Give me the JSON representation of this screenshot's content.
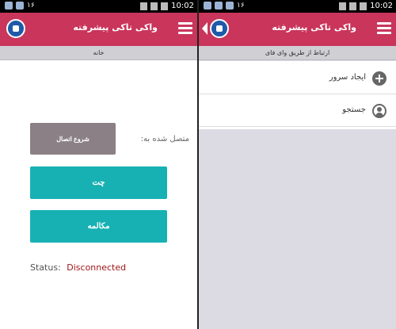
{
  "status_bar": {
    "left_badge": "۱۶",
    "time": "10:02"
  },
  "app": {
    "title": "واکی تاکی پیشرفته",
    "accent_color": "#c9355b",
    "teal_color": "#17b1b3"
  },
  "left_screen": {
    "subtitle": "خانه",
    "connect_button": "شروع اتصال",
    "connected_label": "متصل شده به:",
    "chat_button": "چت",
    "call_button": "مکالمه",
    "status_label": "Status:",
    "status_value": "Disconnected"
  },
  "right_screen": {
    "subtitle": "ارتباط از طریق وای فای",
    "items": [
      {
        "label": "ایجاد سرور",
        "icon": "plus-circle-icon"
      },
      {
        "label": "جستجو",
        "icon": "user-search-icon"
      }
    ]
  }
}
